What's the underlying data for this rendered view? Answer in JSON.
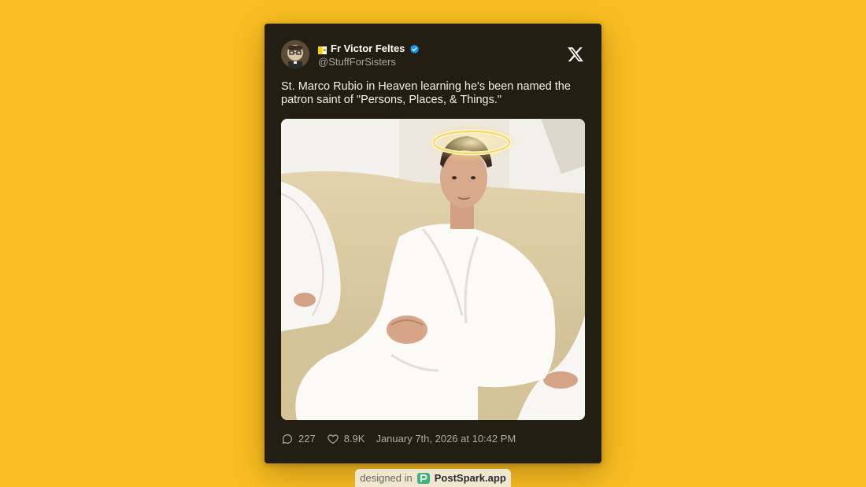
{
  "post": {
    "author_name": "Fr Victor Feltes",
    "author_handle": "@StuffForSisters",
    "text": "St. Marco Rubio in Heaven learning he's been named the patron saint of \"Persons, Places, & Things.\"",
    "replies": "227",
    "likes": "8.9K",
    "timestamp": "January 7th, 2026 at 10:42 PM"
  },
  "icons": {
    "flag": "flag-icon",
    "verified": "verified-badge-icon",
    "platform": "x-logo-icon",
    "replies": "reply-icon",
    "likes": "heart-icon",
    "brand": "postspark-logo-icon"
  },
  "badge": {
    "prefix": "designed in",
    "brand": "PostSpark.app"
  },
  "colors": {
    "background": "#F9BE22",
    "card": "#221E12",
    "verified": "#1D9BF0",
    "badge": "#EFE7D0"
  }
}
